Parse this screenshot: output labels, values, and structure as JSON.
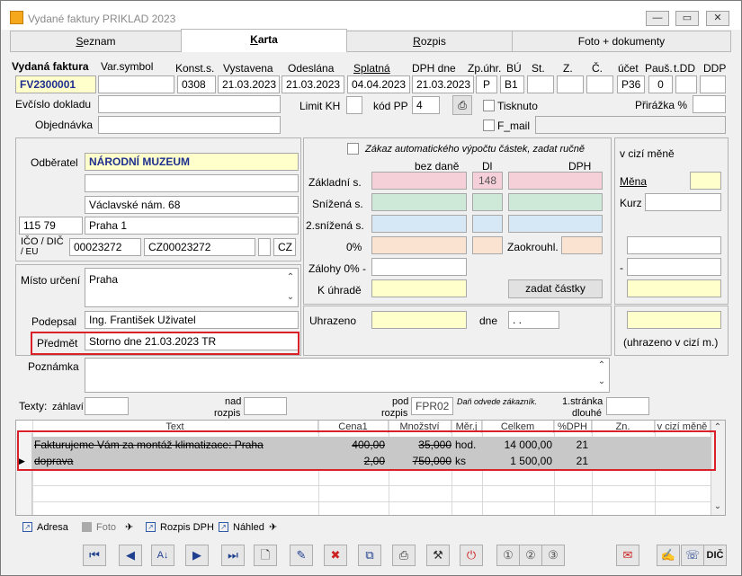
{
  "window": {
    "title": "Vydané faktury PRIKLAD 2023",
    "min": "—",
    "max": "▭",
    "close": "✕"
  },
  "tabs": [
    {
      "label": "Seznam",
      "accel": "S",
      "rest": "eznam"
    },
    {
      "label": "Karta",
      "accel": "K",
      "rest": "arta"
    },
    {
      "label": "Rozpis",
      "accel": "R",
      "rest": "ozpis"
    },
    {
      "label": "Foto + dokumenty"
    }
  ],
  "header": {
    "labels": {
      "doc": "Vydaná faktura",
      "varsym": "Var.symbol",
      "konst": "Konst.s.",
      "vystavena": "Vystavena",
      "odeslana": "Odeslána",
      "splatna": "Splatná",
      "dph_dne": "DPH dne",
      "zpuhr": "Zp.úhr.",
      "bu": "BÚ",
      "st": "St.",
      "z": "Z.",
      "c": "Č.",
      "ucet": "účet",
      "paus": "Pauš.",
      "tdd": "t.DD",
      "ddp": "DDP"
    },
    "values": {
      "doc": "FV2300001",
      "varsym": "",
      "konst": "0308",
      "vystavena": "21.03.2023",
      "odeslana": "21.03.2023",
      "splatna": "04.04.2023",
      "dph_dne": "21.03.2023",
      "zpuhr": "P",
      "bu": "B1",
      "st": "",
      "z": "",
      "c": "",
      "ucet": "P36",
      "paus": "0",
      "tdd": "",
      "ddp": ""
    }
  },
  "row2": {
    "evcislo_label": "Evčíslo dokladu",
    "evcislo": "",
    "limit_label": "Limit KH",
    "kodpp_label": "kód PP",
    "kodpp": "4",
    "tisknuto_label": "Tisknuto",
    "prirazka_label": "Přirážka %",
    "prirazka": "",
    "objednavka_label": "Objednávka",
    "objednavka": "",
    "fmail_label": "F_mail"
  },
  "customer": {
    "odberatel_label": "Odběratel",
    "name": "NÁRODNÍ MUZEUM",
    "line2": "",
    "street": "Václavské nám. 68",
    "zip": "115 79",
    "city": "Praha 1",
    "ico_label": "IČO / DIČ",
    "eu_label": "/ EU",
    "ico": "00023272",
    "dic": "CZ00023272",
    "country": "CZ"
  },
  "place": {
    "label": "Místo určení",
    "value": "Praha"
  },
  "signed": {
    "label": "Podepsal",
    "value": "Ing. František Uživatel"
  },
  "subject": {
    "label": "Předmět",
    "value": "Storno dne 21.03.2023 TR"
  },
  "amounts": {
    "zakaz_label": "Zákaz automatického výpočtu částek, zadat ručně",
    "bez_dane": "bez daně",
    "dl": "Dl",
    "dph": "DPH",
    "zakladni": "Základní s.",
    "snizena": "Snížená s.",
    "snizena2": "2.snížená s.",
    "nula": "0%",
    "zalohy": "Zálohy 0% -",
    "k_uhrade": "K úhradě",
    "dl_value": "148",
    "zaokrouhl": "Zaokrouhl.",
    "zadat_btn": "zadat částky"
  },
  "foreign": {
    "label": "v cizí měně",
    "mena_label": "Měna",
    "kurz_label": "Kurz",
    "minus": "-",
    "note": "(uhrazeno v cizí m.)"
  },
  "paid": {
    "label": "Uhrazeno",
    "dne_label": "dne",
    "dne_value": ". ."
  },
  "note": {
    "label": "Poznámka"
  },
  "texty": {
    "label": "Texty:",
    "zahlavi": "záhlaví",
    "nad": "nad",
    "rozpis": "rozpis",
    "pod": "pod",
    "pod_rozpis": "rozpis",
    "fpr": "FPR02",
    "dan_note": "Daň odvede zákazník.",
    "stranka": "1.stránka",
    "dlouhe": "dlouhé"
  },
  "grid": {
    "headers": [
      "Text",
      "Cena1",
      "Množství",
      "Měr.j",
      "Celkem",
      "%DPH",
      "Zn.",
      "v cizí měně"
    ],
    "rows": [
      {
        "text": "Fakturujeme Vám za montáž klimatizace: Praha",
        "price": "400,00",
        "qty": "35,000",
        "unit": "hod.",
        "total": "14 000,00",
        "vat": "21"
      },
      {
        "text": "doprava",
        "price": "2,00",
        "qty": "750,000",
        "unit": "ks",
        "total": "1 500,00",
        "vat": "21"
      }
    ]
  },
  "bottom": {
    "adresa": "Adresa",
    "foto": "Foto",
    "rozpis_dph": "Rozpis DPH",
    "nahled": "Náhled"
  },
  "colors": {
    "accent_red": "#d9202b",
    "yellow": "#ffffcc",
    "pink": "#f6d0d8",
    "green": "#cfe9d8",
    "blue": "#d6e8f6",
    "peach": "#fbe3d2"
  }
}
